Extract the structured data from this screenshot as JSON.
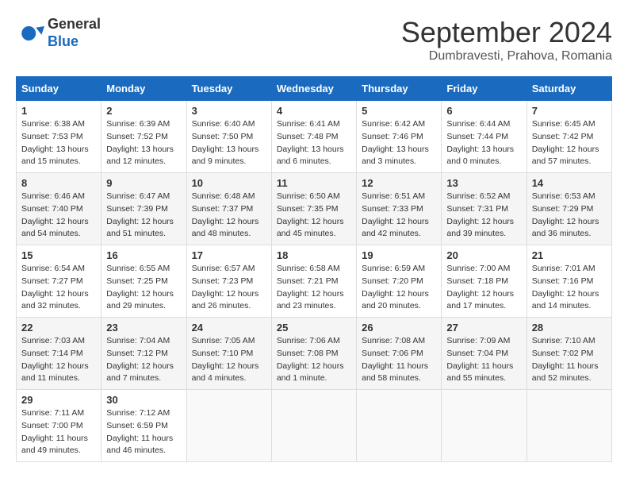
{
  "header": {
    "logo_general": "General",
    "logo_blue": "Blue",
    "month_title": "September 2024",
    "location": "Dumbravesti, Prahova, Romania"
  },
  "days_of_week": [
    "Sunday",
    "Monday",
    "Tuesday",
    "Wednesday",
    "Thursday",
    "Friday",
    "Saturday"
  ],
  "weeks": [
    [
      {
        "day": 1,
        "sunrise": "6:38 AM",
        "sunset": "7:53 PM",
        "daylight": "13 hours and 15 minutes."
      },
      {
        "day": 2,
        "sunrise": "6:39 AM",
        "sunset": "7:52 PM",
        "daylight": "13 hours and 12 minutes."
      },
      {
        "day": 3,
        "sunrise": "6:40 AM",
        "sunset": "7:50 PM",
        "daylight": "13 hours and 9 minutes."
      },
      {
        "day": 4,
        "sunrise": "6:41 AM",
        "sunset": "7:48 PM",
        "daylight": "13 hours and 6 minutes."
      },
      {
        "day": 5,
        "sunrise": "6:42 AM",
        "sunset": "7:46 PM",
        "daylight": "13 hours and 3 minutes."
      },
      {
        "day": 6,
        "sunrise": "6:44 AM",
        "sunset": "7:44 PM",
        "daylight": "13 hours and 0 minutes."
      },
      {
        "day": 7,
        "sunrise": "6:45 AM",
        "sunset": "7:42 PM",
        "daylight": "12 hours and 57 minutes."
      }
    ],
    [
      {
        "day": 8,
        "sunrise": "6:46 AM",
        "sunset": "7:40 PM",
        "daylight": "12 hours and 54 minutes."
      },
      {
        "day": 9,
        "sunrise": "6:47 AM",
        "sunset": "7:39 PM",
        "daylight": "12 hours and 51 minutes."
      },
      {
        "day": 10,
        "sunrise": "6:48 AM",
        "sunset": "7:37 PM",
        "daylight": "12 hours and 48 minutes."
      },
      {
        "day": 11,
        "sunrise": "6:50 AM",
        "sunset": "7:35 PM",
        "daylight": "12 hours and 45 minutes."
      },
      {
        "day": 12,
        "sunrise": "6:51 AM",
        "sunset": "7:33 PM",
        "daylight": "12 hours and 42 minutes."
      },
      {
        "day": 13,
        "sunrise": "6:52 AM",
        "sunset": "7:31 PM",
        "daylight": "12 hours and 39 minutes."
      },
      {
        "day": 14,
        "sunrise": "6:53 AM",
        "sunset": "7:29 PM",
        "daylight": "12 hours and 36 minutes."
      }
    ],
    [
      {
        "day": 15,
        "sunrise": "6:54 AM",
        "sunset": "7:27 PM",
        "daylight": "12 hours and 32 minutes."
      },
      {
        "day": 16,
        "sunrise": "6:55 AM",
        "sunset": "7:25 PM",
        "daylight": "12 hours and 29 minutes."
      },
      {
        "day": 17,
        "sunrise": "6:57 AM",
        "sunset": "7:23 PM",
        "daylight": "12 hours and 26 minutes."
      },
      {
        "day": 18,
        "sunrise": "6:58 AM",
        "sunset": "7:21 PM",
        "daylight": "12 hours and 23 minutes."
      },
      {
        "day": 19,
        "sunrise": "6:59 AM",
        "sunset": "7:20 PM",
        "daylight": "12 hours and 20 minutes."
      },
      {
        "day": 20,
        "sunrise": "7:00 AM",
        "sunset": "7:18 PM",
        "daylight": "12 hours and 17 minutes."
      },
      {
        "day": 21,
        "sunrise": "7:01 AM",
        "sunset": "7:16 PM",
        "daylight": "12 hours and 14 minutes."
      }
    ],
    [
      {
        "day": 22,
        "sunrise": "7:03 AM",
        "sunset": "7:14 PM",
        "daylight": "12 hours and 11 minutes."
      },
      {
        "day": 23,
        "sunrise": "7:04 AM",
        "sunset": "7:12 PM",
        "daylight": "12 hours and 7 minutes."
      },
      {
        "day": 24,
        "sunrise": "7:05 AM",
        "sunset": "7:10 PM",
        "daylight": "12 hours and 4 minutes."
      },
      {
        "day": 25,
        "sunrise": "7:06 AM",
        "sunset": "7:08 PM",
        "daylight": "12 hours and 1 minute."
      },
      {
        "day": 26,
        "sunrise": "7:08 AM",
        "sunset": "7:06 PM",
        "daylight": "11 hours and 58 minutes."
      },
      {
        "day": 27,
        "sunrise": "7:09 AM",
        "sunset": "7:04 PM",
        "daylight": "11 hours and 55 minutes."
      },
      {
        "day": 28,
        "sunrise": "7:10 AM",
        "sunset": "7:02 PM",
        "daylight": "11 hours and 52 minutes."
      }
    ],
    [
      {
        "day": 29,
        "sunrise": "7:11 AM",
        "sunset": "7:00 PM",
        "daylight": "11 hours and 49 minutes."
      },
      {
        "day": 30,
        "sunrise": "7:12 AM",
        "sunset": "6:59 PM",
        "daylight": "11 hours and 46 minutes."
      },
      null,
      null,
      null,
      null,
      null
    ]
  ]
}
